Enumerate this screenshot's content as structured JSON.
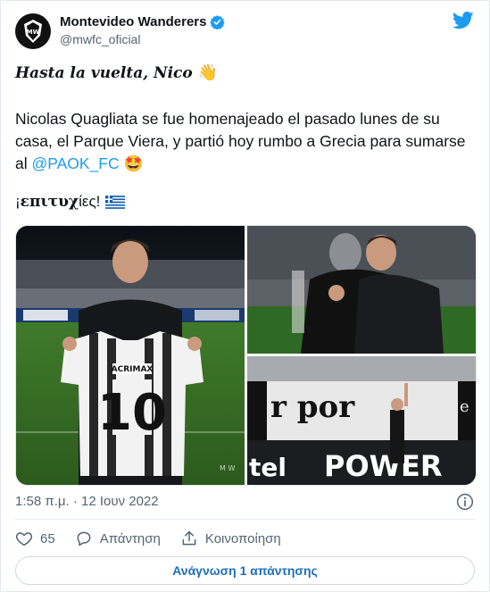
{
  "account": {
    "name": "Montevideo Wanderers",
    "handle": "@mwfc_oficial"
  },
  "tweet": {
    "headline": "Hasta la vuelta, Nico",
    "headline_emoji": "👋",
    "body_part1": "Nicolas Quagliata se fue homenajeado el pasado lunes de su casa, el Parque Viera, y partió hoy rumbo a Grecia para sumarse al ",
    "mention": "@PAOK_FC",
    "body_emoji": "🤩",
    "greek_prefix": "¡",
    "greek_bold": "επιτυχ",
    "greek_suffix": "ίες!",
    "timestamp": "1:58 π.μ. · 12 Ιουν 2022"
  },
  "media": {
    "photo1_caption": "Nico holding number 10 shirt",
    "photo2_caption": "Embrace",
    "photo3_caption": "Waving at stand"
  },
  "actions": {
    "likes": "65",
    "reply_label": "Απάντηση",
    "share_label": "Κοινοποίηση",
    "read_replies": "Ανάγνωση 1 απάντησης"
  },
  "colors": {
    "accent": "#1d9bf0",
    "muted": "#536471"
  }
}
